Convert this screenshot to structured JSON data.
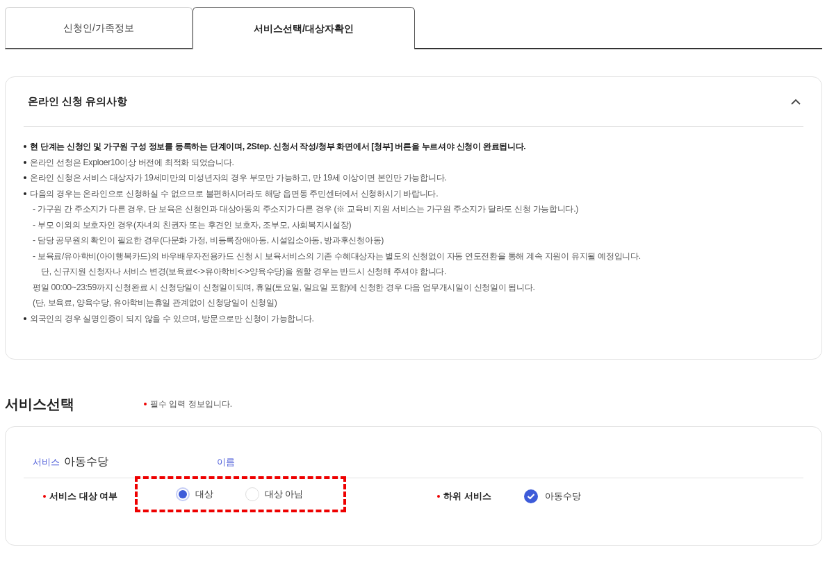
{
  "tabs": [
    {
      "label": "신청인/가족정보",
      "selected": false
    },
    {
      "label": "서비스선택/대상자확인",
      "selected": true
    }
  ],
  "notice": {
    "title": "온라인 신청 유의사항",
    "expanded": true,
    "lines": [
      {
        "kind": "bullet",
        "bold": true,
        "text": "현 단계는 신청인 및 가구원 구성 정보를 등록하는 단계이며, 2Step. 신청서 작성/청부 화면에서 [청부] 버튼을 누르셔야 신청이 완료됩니다."
      },
      {
        "kind": "bullet",
        "bold": false,
        "text": "온라인 선청은 Exploer10이상 버전에 최적화 되었습니다."
      },
      {
        "kind": "bullet",
        "bold": false,
        "text": "온라인 신청은 서비스 대상자가 19세미만의 미성년자의 경우 부모만 가능하고, 만 19세 이상이면 본인만 가능합니다."
      },
      {
        "kind": "bullet",
        "bold": false,
        "text": "다음의 경우는 온라인으로 신청하실 수 없으므로 불편하시더라도 해당 읍면동 주민센터에서 신청하시기 바랍니다."
      },
      {
        "kind": "sub",
        "bold": false,
        "text": "- 가구원 간 주소지가 다른 경우, 단 보육은 신청인과 대상아동의 주소지가 다른 경우 (※ 교육비 지원 서비스는 가구원 주소지가 달라도 신청 가능합니다.)"
      },
      {
        "kind": "sub",
        "bold": false,
        "text": "- 부모 이외의 보호자인 경우(자녀의 친권자 또는 후견인 보호자, 조부모, 사회복지시설장)"
      },
      {
        "kind": "sub",
        "bold": false,
        "text": "- 담당 공무원의 확인이 필요한 경우(다문화 가정, 비등록장애아동, 시설입소아동, 방과후신청아동)"
      },
      {
        "kind": "sub",
        "bold": false,
        "text": "- 보육료/유아학비(아이행복카드)의 바우배우자전용카드 신청 시 보육서비스의 기존 수혜대상자는 별도의 신청없이 자동 연도전환을 통해 계속 지원이 유지될 예정입니다."
      },
      {
        "kind": "cont",
        "bold": false,
        "text": "단, 신규지원 신청자나 서비스 변경(보육료<->유아학비<->양육수당)을 원할 경우는 반드시 신청해 주셔야 합니다."
      },
      {
        "kind": "sub",
        "bold": false,
        "text": "평일 00:00~23:59까지 신청완료 시 신청당일이 신청일이되며, 휴일(토요일, 일요일 포함)에 신청한 경우 다음 업무개시일이 신청일이 됩니다."
      },
      {
        "kind": "sub",
        "bold": false,
        "text": "(단, 보육료, 양육수당, 유아학비는휴일 관계없이 신청당일이 신청일)"
      },
      {
        "kind": "bullet",
        "bold": false,
        "text": "외국인의 경우 실명인증이 되지 않을 수 있으며, 방문으로만 신청이 가능합니다."
      }
    ]
  },
  "section": {
    "title": "서비스선택",
    "required_note": "필수 입력 정보입니다."
  },
  "service": {
    "label": "서비스",
    "name": "아동수당",
    "name_label": "이름",
    "target_label": "서비스 대상 여부",
    "options": [
      {
        "label": "대상",
        "selected": true
      },
      {
        "label": "대상 아님",
        "selected": false
      }
    ],
    "sub_label": "하위 서비스",
    "sub_services": [
      {
        "label": "아동수당",
        "checked": true
      }
    ]
  }
}
